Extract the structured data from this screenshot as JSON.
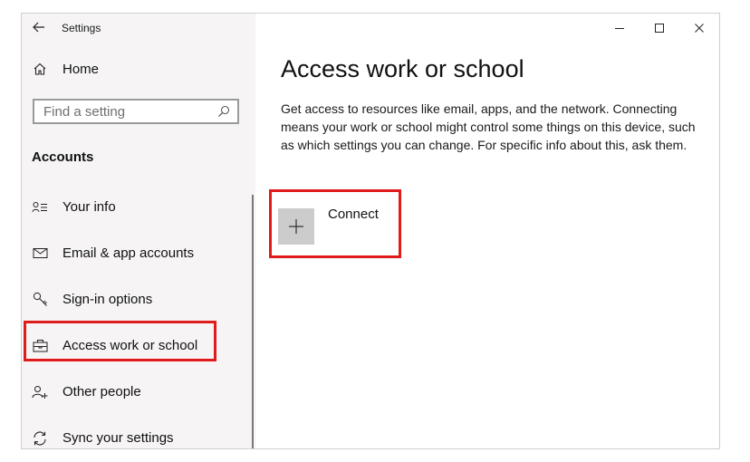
{
  "window": {
    "title": "Settings"
  },
  "sidebar": {
    "home_label": "Home",
    "search_placeholder": "Find a setting",
    "section_header": "Accounts",
    "items": [
      {
        "label": "Your info",
        "icon": "contact-info-icon"
      },
      {
        "label": "Email & app accounts",
        "icon": "mail-icon"
      },
      {
        "label": "Sign-in options",
        "icon": "key-icon"
      },
      {
        "label": "Access work or school",
        "icon": "briefcase-icon",
        "selected": true
      },
      {
        "label": "Other people",
        "icon": "add-person-icon"
      },
      {
        "label": "Sync your settings",
        "icon": "sync-icon"
      }
    ]
  },
  "main": {
    "title": "Access work or school",
    "description": "Get access to resources like email, apps, and the network. Connecting means your work or school might control some things on this device, such as which settings you can change. For specific info about this, ask them.",
    "connect_label": "Connect"
  },
  "colors": {
    "sidebar_bg": "#f6f4f5",
    "highlight_border": "#e01b1b",
    "connect_tile": "#cccccc"
  }
}
